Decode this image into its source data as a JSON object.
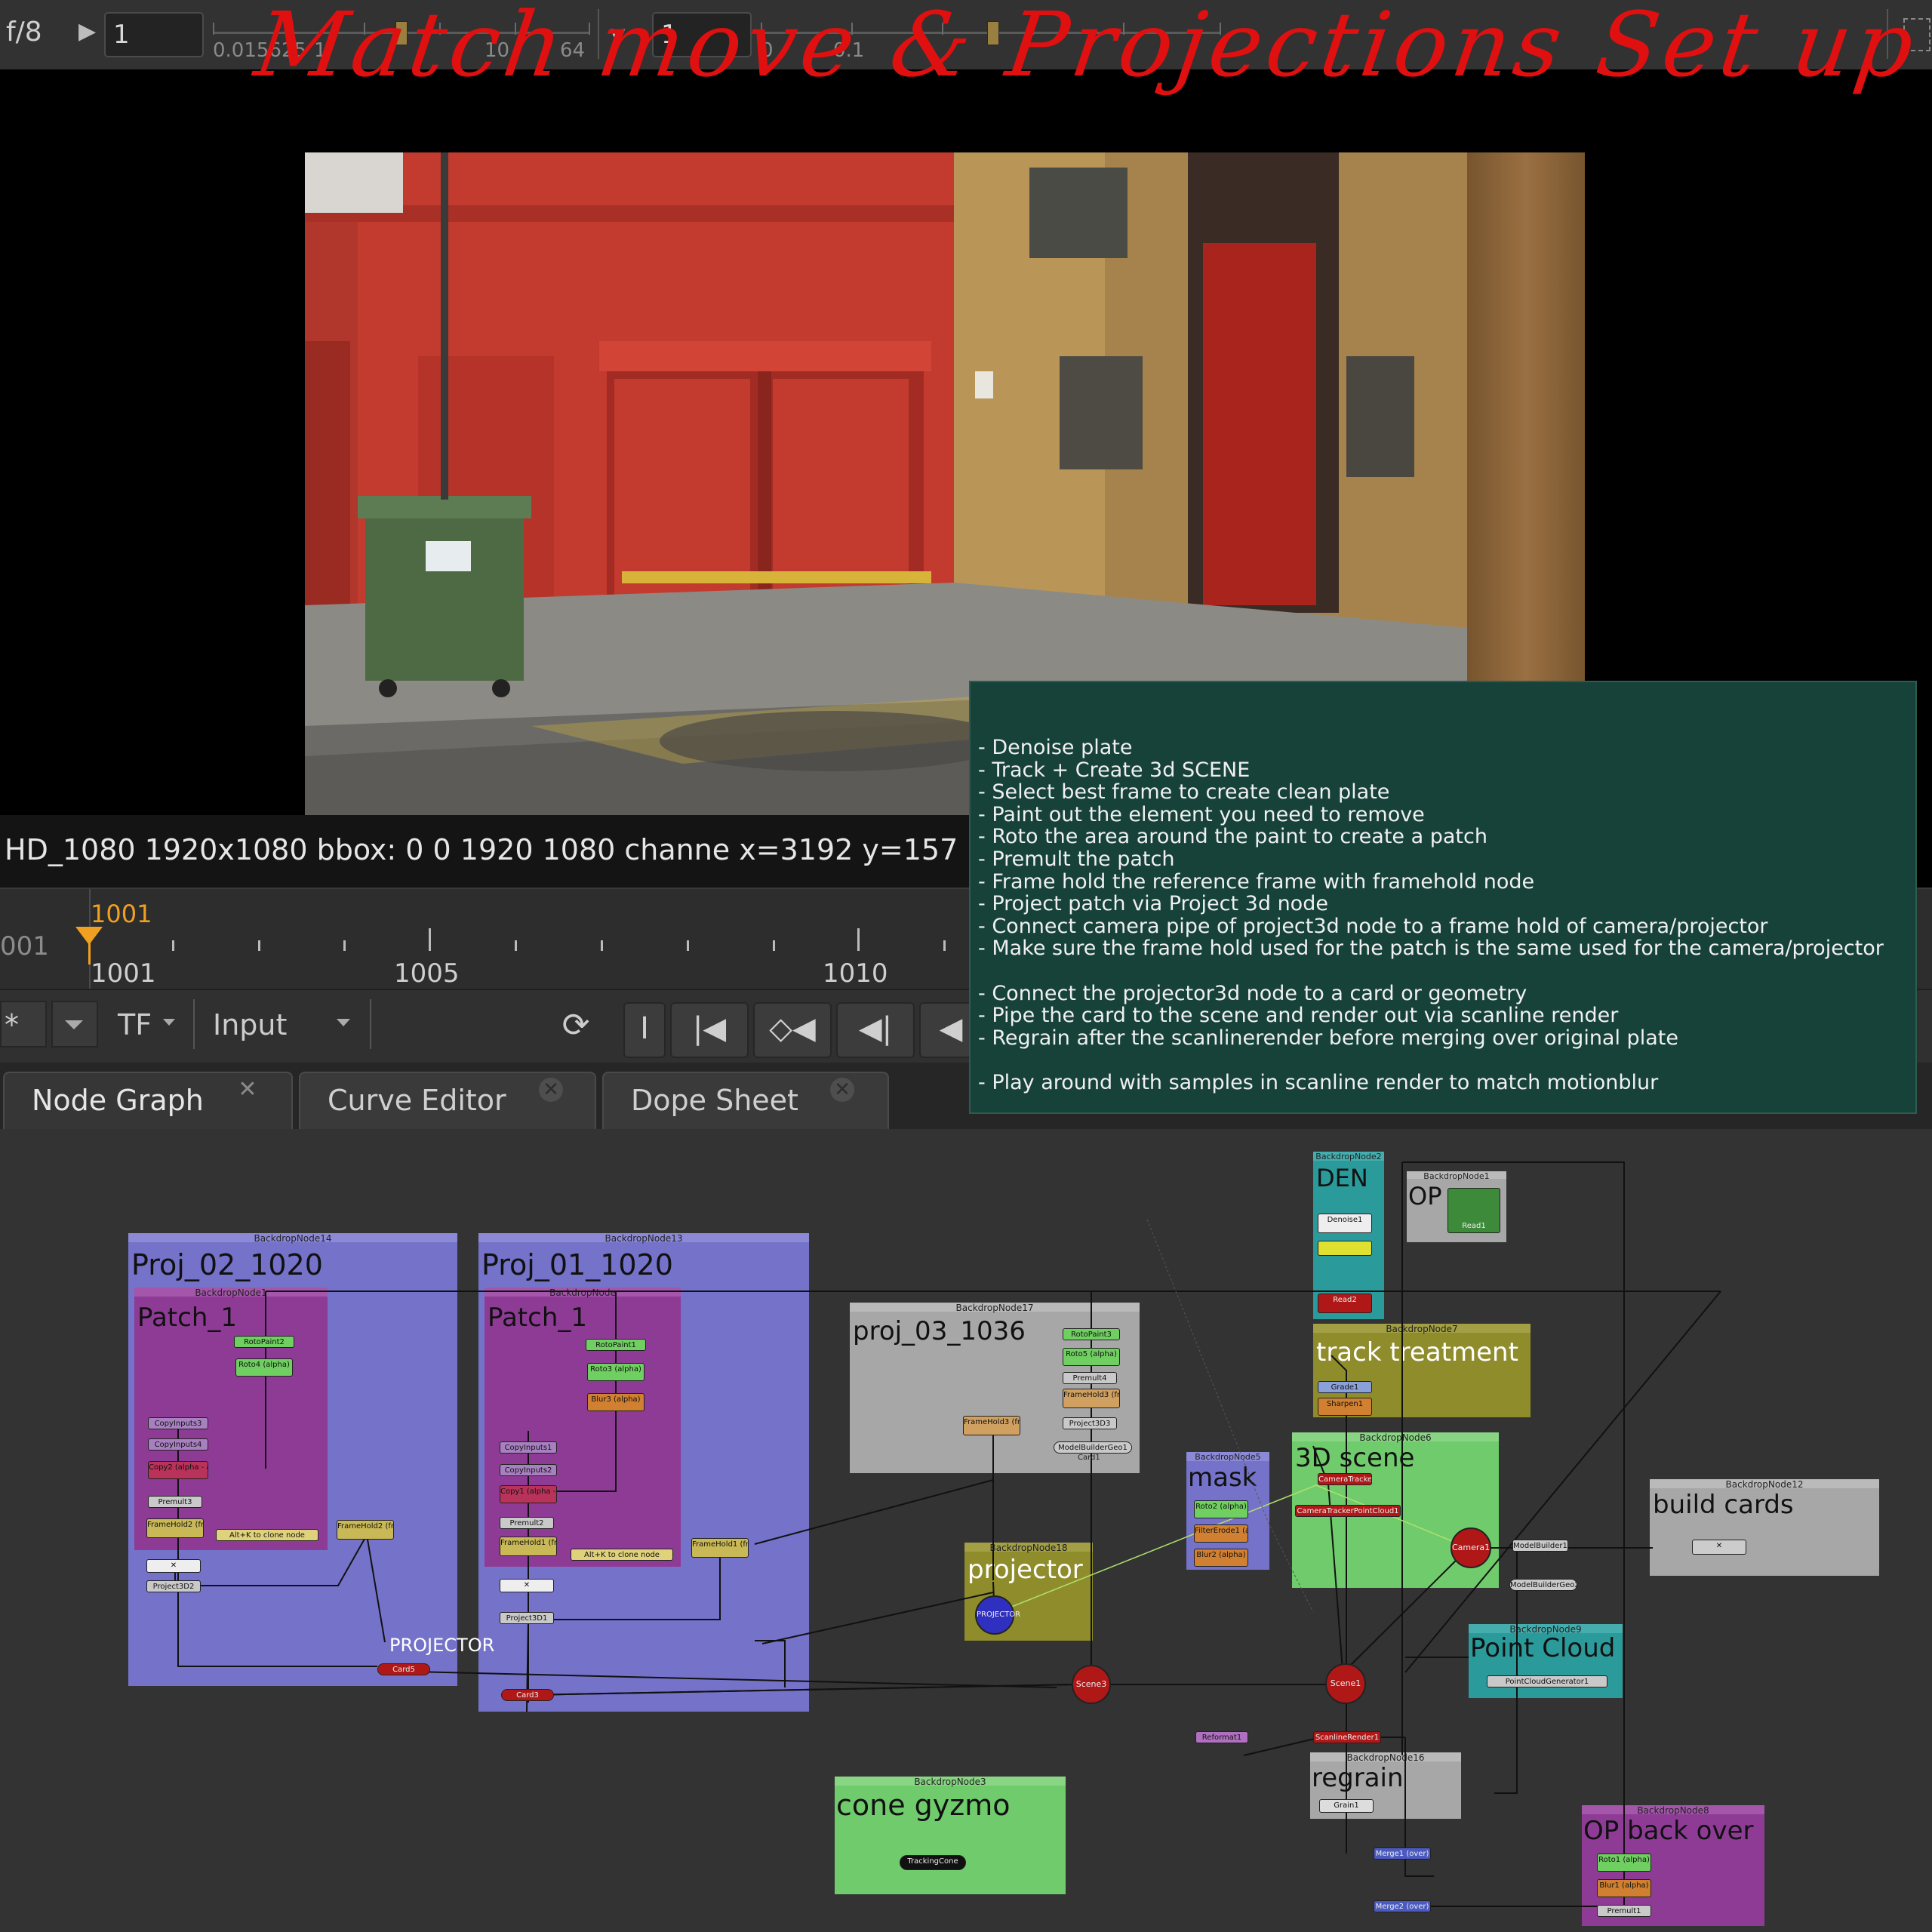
{
  "toolbar": {
    "fstop": "f/8",
    "play_glyph": "▶",
    "frame_value": "1",
    "gain_slider_labels": [
      "0.015625",
      "1",
      "10",
      "64"
    ],
    "gamma_label": "y",
    "gamma_value": "1",
    "gamma_slider_labels": [
      "0",
      "0.1"
    ]
  },
  "annotation": {
    "handwriting": "Match move & Projections Set up"
  },
  "info_bar": {
    "text": "HD_1080 1920x1080  bbox: 0 0 1920 1080 channe  x=3192 y=157"
  },
  "timeline": {
    "current_frame": "1001",
    "left_partial": "001",
    "ticks": [
      "1001",
      "1005",
      "1010"
    ]
  },
  "controls": {
    "channel_partial": "*",
    "tf_label": "TF",
    "input_label": "Input",
    "buttons": [
      "loop-icon",
      "in-point-icon",
      "first-frame-icon",
      "prev-keyframe-icon",
      "prev-frame-icon",
      "play-backward-icon"
    ]
  },
  "tabs": [
    {
      "label": "Node Graph",
      "active": true
    },
    {
      "label": "Curve Editor",
      "active": false
    },
    {
      "label": "Dope Sheet",
      "active": false
    }
  ],
  "sticky_note": {
    "lines": [
      "- Denoise plate",
      "- Track + Create 3d SCENE",
      "- Select best frame to create clean plate",
      "- Paint out the element you need to remove",
      "- Roto the area around the paint to create a patch",
      "- Premult the patch",
      "- Frame hold the reference frame with framehold node",
      "- Project patch via Project 3d node",
      "- Connect camera pipe of project3d node to a frame hold of camera/projector",
      "- Make sure the frame hold used for the patch is the same used for the camera/projector",
      "",
      "- Connect the projector3d node to a card or geometry",
      "- Pipe the card to the scene and render out via scanline render",
      "- Regrain after the scanlinerender before merging over original plate",
      "",
      "- Play around with samples in scanline render to match motionblur"
    ]
  },
  "backdrops": {
    "bd14": {
      "title": "BackdropNode14",
      "label": "Proj_02_1020"
    },
    "bd13": {
      "title": "BackdropNode13",
      "label": "Proj_01_1020"
    },
    "bd_patch_a": {
      "title": "BackdropNode1",
      "label": "Patch_1"
    },
    "bd_patch_b": {
      "title": "BackdropNode",
      "label": "Patch_1"
    },
    "bd17": {
      "title": "BackdropNode17",
      "label": "proj_03_1036"
    },
    "bd18": {
      "title": "BackdropNode18",
      "label": "projector"
    },
    "bd2": {
      "title": "BackdropNode2",
      "label": "DEN"
    },
    "bd1": {
      "title": "BackdropNode1",
      "label": "OP"
    },
    "bd7": {
      "title": "BackdropNode7",
      "label": "track treatment"
    },
    "bd5": {
      "title": "BackdropNode5",
      "label": "mask"
    },
    "bd6": {
      "title": "BackdropNode6",
      "label": "3D scene"
    },
    "bd12": {
      "title": "BackdropNode12",
      "label": "build cards"
    },
    "bd9": {
      "title": "BackdropNode9",
      "label": "Point Cloud"
    },
    "bd16": {
      "title": "BackdropNode16",
      "label": "regrain"
    },
    "bd3": {
      "title": "BackdropNode3",
      "label": "cone gyzmo"
    },
    "bd8": {
      "title": "BackdropNode8",
      "label": "OP back over"
    }
  },
  "nodes": {
    "paint2": "RotoPaint2",
    "roto4": "Roto4 (alpha)",
    "copy_in_a1": "CopyInputs3",
    "copy_in_a2": "CopyInputs4",
    "copy2": "Copy2 (alpha - a.alpha)",
    "premult3": "Premult3",
    "framehold2a": "FrameHold2 (frame 1020)",
    "clone_hint_a": "Alt+K to clone node",
    "framehold2b": "FrameHold2 (frame 1020)",
    "project3d2": "Project3D2",
    "card5": "Card5",
    "projector_label": "PROJECTOR",
    "paint1": "RotoPaint1",
    "roto3": "Roto3 (alpha)",
    "blur3": "Blur3 (alpha)",
    "copy_in_b1": "CopyInputs1",
    "copy_in_b2": "CopyInputs2",
    "copy1": "Copy1 (alpha - a.alpha)",
    "premult2": "Premult2",
    "framehold1a": "FrameHold1 (frame 1020)",
    "clone_hint_b": "Alt+K to clone node",
    "framehold1b": "FrameHold1 (frame 1020)",
    "project3d1": "Project3D1",
    "card3": "Card3",
    "paint3": "RotoPaint3",
    "roto5": "Roto5 (alpha)",
    "premult4": "Premult4",
    "framehold3a": "FrameHold3 (frame 1036)",
    "framehold3b": "FrameHold3 (frame 1036)",
    "project3d3": "Project3D3",
    "modelbuildergeo1": "ModelBuilderGeo1",
    "card1": "Card1",
    "projector_node": "PROJECTOR",
    "scene3": "Scene3",
    "denoise": "Denoise1",
    "read2": "Read2",
    "read1": "Read1",
    "grade1": "Grade1",
    "sharpen1": "Sharpen1",
    "roto2": "Roto2 (alpha)",
    "filtererode1": "FilterErode1 (alpha)",
    "blur2": "Blur2 (alpha)",
    "cameratracker": "CameraTracker1",
    "cameratrackerpc": "CameraTrackerPointCloud1",
    "camera1": "Camera1",
    "modelbuilder": "ModelBuilder1",
    "modelbuildergeo2": "ModelBuilderGeo2",
    "pointcloudgen": "PointCloudGenerator1",
    "scene1": "Scene1",
    "scanline": "ScanlineRender1",
    "reformat1": "Reformat1",
    "grain": "Grain1",
    "trackingcone": "TrackingCone",
    "merge1": "Merge1 (over)",
    "merge2": "Merge2 (over)",
    "roto1": "Roto1 (alpha)",
    "blur1": "Blur1 (alpha)",
    "premult1": "Premult1"
  }
}
